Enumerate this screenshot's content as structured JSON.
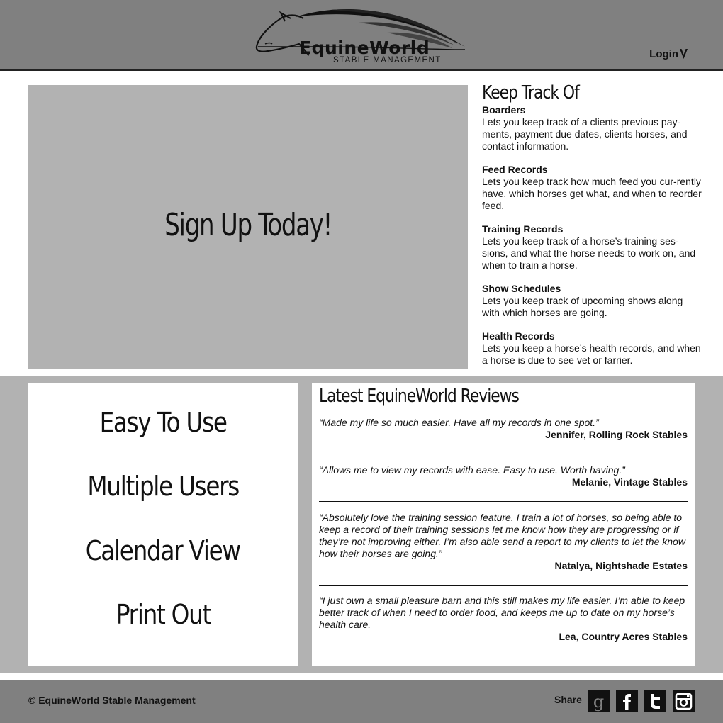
{
  "header": {
    "logo_name": "EquineWorld",
    "logo_sub": "STABLE MANAGEMENT",
    "login_label": "Login",
    "login_caret": "chevron-down-icon"
  },
  "hero": {
    "label": "Sign Up Today!"
  },
  "keep_track": {
    "title": "Keep Track Of",
    "items": [
      {
        "title": "Boarders",
        "desc": "Lets you keep track of a clients previous pay-ments, payment due dates, clients horses, and contact information."
      },
      {
        "title": "Feed Records",
        "desc": "Lets you keep track how much feed you cur-rently have, which horses get what, and when to reorder feed."
      },
      {
        "title": "Training Records",
        "desc": "Lets you keep track of a horse’s training ses-sions, and what the horse needs to work on, and when to train a horse."
      },
      {
        "title": "Show Schedules",
        "desc": "Lets you keep track of upcoming shows along with which horses are going."
      },
      {
        "title": "Health Records",
        "desc": "Lets you keep a horse’s health records, and when a horse is due to see vet or farrier."
      }
    ]
  },
  "perks": [
    "Easy To Use",
    "Multiple Users",
    "Calendar View",
    "Print Out"
  ],
  "reviews": {
    "title": "Latest EquineWorld Reviews",
    "items": [
      {
        "quote": "“Made my life so much easier.  Have all my records in one spot.”",
        "author": "Jennifer, Rolling Rock Stables"
      },
      {
        "quote": "“Allows me to view my records with ease.  Easy to use. Worth having.”",
        "author": "Melanie, Vintage Stables"
      },
      {
        "quote": "“Absolutely love the training session feature.  I train a lot of horses, so being able to keep a record of their training sessions let me know how they are progressing or if they’re not improving either.  I’m also able send a report to my clients to let the know how their horses are going.”",
        "author": "Natalya, Nightshade Estates"
      },
      {
        "quote": "“I just own a small pleasure barn and this still makes my life easier.  I’m able to keep better track of when I need to order food, and keeps me up to date on my horse’s health care.",
        "author": "Lea, Country Acres Stables"
      }
    ]
  },
  "footer": {
    "copyright": "© EquineWorld Stable Management",
    "share_label": "Share",
    "social": [
      {
        "icon": "google-icon",
        "glyph": "g"
      },
      {
        "icon": "facebook-icon",
        "glyph": "f"
      },
      {
        "icon": "twitter-icon",
        "glyph": "t"
      },
      {
        "icon": "instagram-icon",
        "glyph": ""
      }
    ]
  },
  "colors": {
    "header_bg": "#808080",
    "hero_bg": "#b2b2b2",
    "band_bg": "#b2b2b2",
    "footer_bg": "#808080",
    "icon_bg": "#111111"
  }
}
